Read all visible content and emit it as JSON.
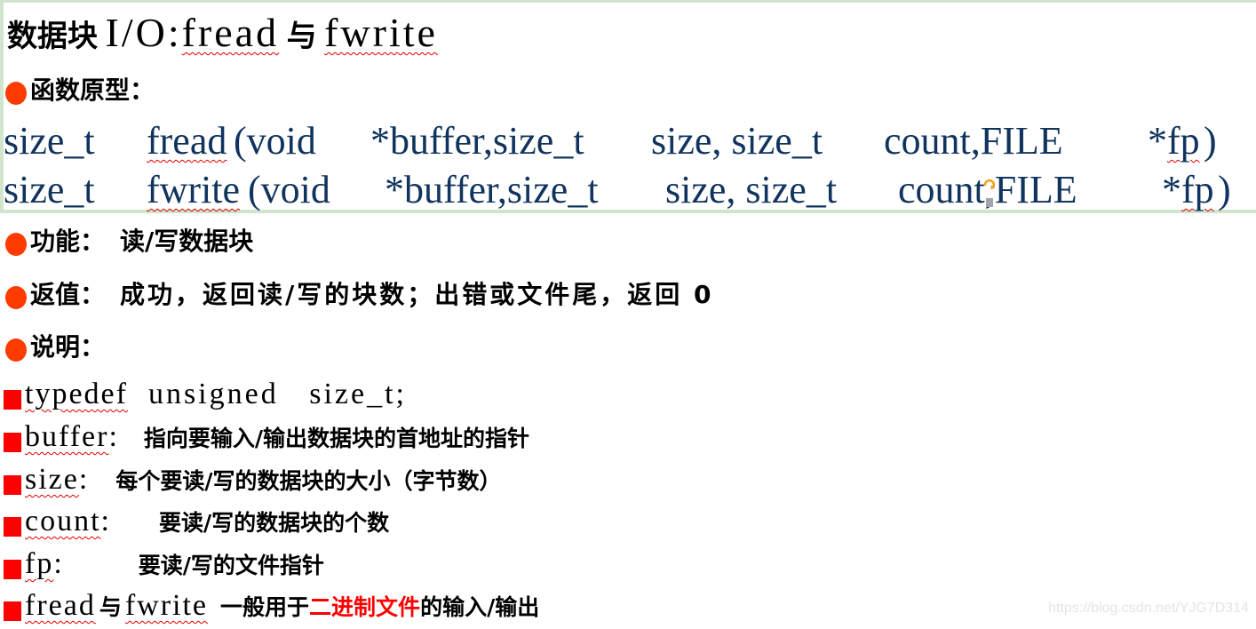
{
  "title": {
    "prefix": "数据块",
    "io": "I/O:",
    "fread": "fread",
    "conj": "与",
    "fwrite": "fwrite"
  },
  "prototype_heading": "函数原型：",
  "prototypes": [
    {
      "ret": "size_t",
      "name": "fread",
      "args": [
        "(void",
        "*buffer,size_t",
        "size, size_t",
        "count,FILE",
        "*",
        "fp",
        ")"
      ]
    },
    {
      "ret": "size_t",
      "name": "fwrite",
      "args": [
        "(void",
        "*buffer,size_t",
        "size, size_t",
        "count,FILE",
        "*",
        "fp",
        ")"
      ]
    }
  ],
  "function": {
    "label": "功能：",
    "text": "读/写数据块"
  },
  "return": {
    "label": "返值：",
    "text": "成功，返回读/写的块数；出错或文件尾，返回 0"
  },
  "notes_heading": "说明：",
  "notes": [
    {
      "key": "typedef",
      "text": "  unsigned   size_t;"
    },
    {
      "key": "buffer",
      "sep": ":",
      "text": "指向要输入/输出数据块的首地址的指针"
    },
    {
      "key": "size",
      "sep": ":",
      "text": "每个要读/写的数据块的大小（字节数）"
    },
    {
      "key": "count",
      "sep": ":",
      "text": "要读/写的数据块的个数"
    },
    {
      "key": "fp",
      "sep": ":",
      "text": "要读/写的文件指针"
    }
  ],
  "last_note": {
    "fread": "fread",
    "conj": "与",
    "fwrite": "fwrite",
    "text_before": "一般用于",
    "highlight": "二进制文件",
    "text_after": "的输入/输出"
  },
  "colors": {
    "bullet": "#ff3b00",
    "square": "#ff0000",
    "code": "#10345e",
    "frame": "#cfe6cc",
    "highlight": "#ff0000"
  },
  "watermark": "https://blog.csdn.net/YJG7D314"
}
